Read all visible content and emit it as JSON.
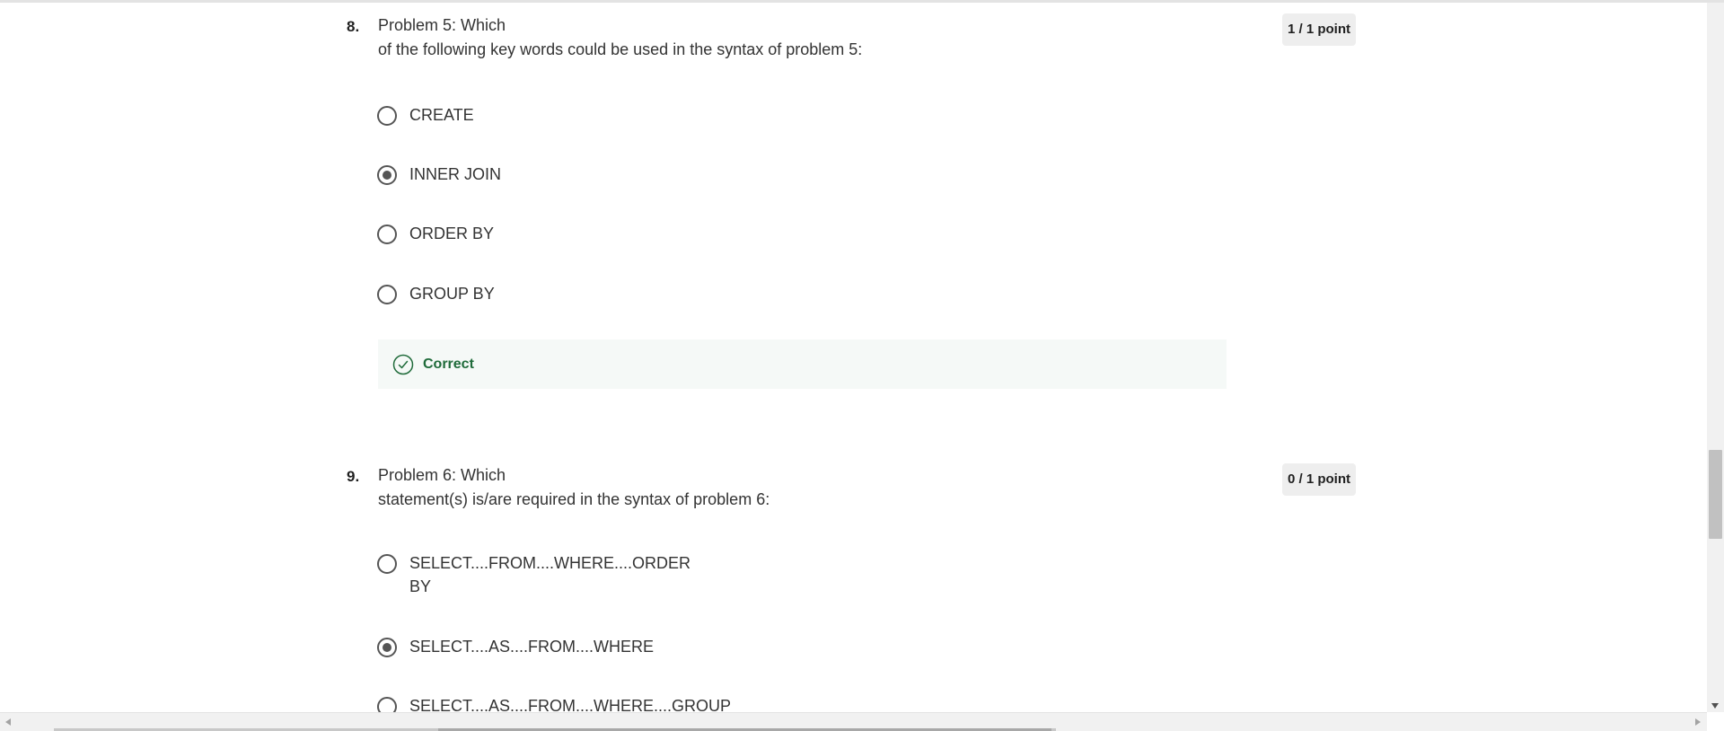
{
  "questions": [
    {
      "number": "8.",
      "prompt_line1": "Problem 5: Which",
      "prompt_line2": "of the following key words could be used in the syntax of problem 5:",
      "points": "1 / 1 point",
      "options": [
        {
          "label": "CREATE",
          "checked": false
        },
        {
          "label": "INNER JOIN",
          "checked": true
        },
        {
          "label": "ORDER BY",
          "checked": false
        },
        {
          "label": "GROUP BY",
          "checked": false
        }
      ],
      "feedback": {
        "label": "Correct",
        "icon": "check-circle-icon",
        "color": "#1f6b3a"
      }
    },
    {
      "number": "9.",
      "prompt_line1": "Problem 6: Which",
      "prompt_line2": "statement(s) is/are required in the syntax of problem 6:",
      "points": "0 / 1 point",
      "options": [
        {
          "label_line1": "SELECT....FROM....WHERE....ORDER",
          "label_line2": "BY",
          "checked": false
        },
        {
          "label": "SELECT....AS....FROM....WHERE",
          "checked": true
        },
        {
          "label": "SELECT....AS....FROM....WHERE....GROUP",
          "checked": false
        }
      ]
    }
  ]
}
